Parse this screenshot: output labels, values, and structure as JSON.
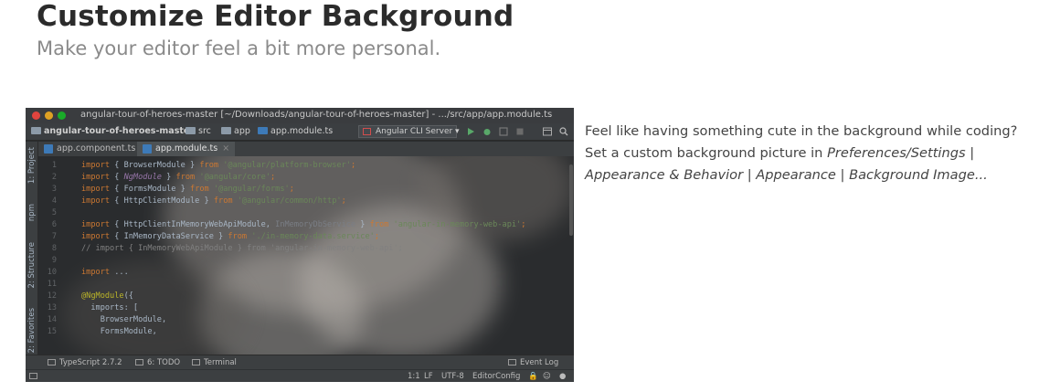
{
  "header": {
    "title": "Customize Editor Background",
    "subtitle": "Make your editor feel a bit more personal."
  },
  "description": {
    "text_before": "Feel like having something cute in the background while coding? Set a custom background picture in ",
    "path": "Preferences/Settings | Appearance & Behavior | Appearance | Background Image..."
  },
  "ide": {
    "window_title": "angular-tour-of-heroes-master [~/Downloads/angular-tour-of-heroes-master] - .../src/app/app.module.ts",
    "breadcrumb": [
      "angular-tour-of-heroes-master",
      "src",
      "app",
      "app.module.ts"
    ],
    "run_config": "Angular CLI Server",
    "tabs": [
      {
        "label": "app.component.ts",
        "active": false
      },
      {
        "label": "app.module.ts",
        "active": true
      }
    ],
    "left_tool_tabs": [
      "1: Project",
      "npm",
      "2: Structure",
      "2: Favorites"
    ],
    "line_numbers": [
      "1",
      "2",
      "3",
      "4",
      "5",
      "6",
      "7",
      "8",
      "9",
      "10",
      "11",
      "12",
      "13",
      "14",
      "15"
    ],
    "code": {
      "l1": {
        "a": "import",
        "b": " { BrowserModule } ",
        "c": "from",
        "d": " '@angular/platform-browser'",
        "e": ";"
      },
      "l2": {
        "a": "import",
        "b": " { ",
        "it": "NgModule",
        "b2": " } ",
        "c": "from",
        "d": " '@angular/core'",
        "e": ";"
      },
      "l3": {
        "a": "import",
        "b": " { FormsModule } ",
        "c": "from",
        "d": " '@angular/forms'",
        "e": ";"
      },
      "l4": {
        "a": "import",
        "b": " { HttpClientModule } ",
        "c": "from",
        "d": " '@angular/common/http'",
        "e": ";"
      },
      "l6": {
        "a": "import",
        "b": " { HttpClientInMemoryWebApiModule, ",
        "dim": "InMemoryDbService",
        "b2": " } ",
        "c": "from",
        "d": " 'angular-in-memory-web-api'",
        "e": ";"
      },
      "l7": {
        "a": "import",
        "b": " { InMemoryDataService } ",
        "c": "from",
        "d": " './in-memory-data.service'",
        "e": ";"
      },
      "l8": "// import { InMemoryWebApiModule } from 'angular-in-memory-web-api';",
      "l10": {
        "a": "import",
        "b": " ..."
      },
      "l12": {
        "ann": "@NgModule",
        "b": "({"
      },
      "l13": "  imports: [",
      "l14": "    BrowserModule,",
      "l15": "    FormsModule,"
    },
    "tool_windows": [
      "TypeScript 2.7.2",
      "6: TODO",
      "Terminal",
      "Event Log"
    ],
    "status": [
      "1:1",
      "LF",
      "UTF-8",
      "EditorConfig"
    ]
  },
  "colors": {
    "keyword": "#cc7832",
    "string": "#6a8759",
    "annotation": "#bbb529",
    "ide_background": "#2a2c2e"
  }
}
